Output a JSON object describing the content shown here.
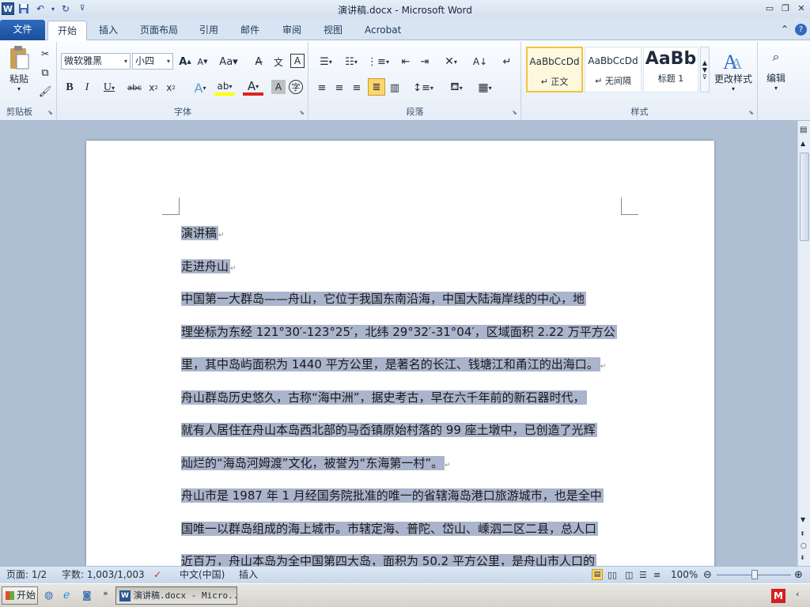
{
  "window": {
    "title": "演讲稿.docx - Microsoft Word"
  },
  "tabs": [
    {
      "label": "文件"
    },
    {
      "label": "开始"
    },
    {
      "label": "插入"
    },
    {
      "label": "页面布局"
    },
    {
      "label": "引用"
    },
    {
      "label": "邮件"
    },
    {
      "label": "审阅"
    },
    {
      "label": "视图"
    },
    {
      "label": "Acrobat"
    }
  ],
  "ribbon": {
    "clipboard": {
      "paste": "粘贴",
      "label": "剪贴板"
    },
    "font": {
      "family": "微软雅黑",
      "size": "小四",
      "label": "字体"
    },
    "paragraph": {
      "label": "段落"
    },
    "styles": {
      "label": "样式",
      "items": [
        {
          "preview": "AaBbCcDd",
          "name": "↵ 正文"
        },
        {
          "preview": "AaBbCcDd",
          "name": "↵ 无间隔"
        },
        {
          "preview": "AaBb",
          "name": "标题 1"
        }
      ],
      "change": "更改样式"
    },
    "editing": {
      "label": "编辑"
    }
  },
  "document": {
    "lines": [
      {
        "text": "演讲稿",
        "mark": "↵"
      },
      {
        "text": "走进舟山",
        "mark": "↵"
      },
      {
        "text": "中国第一大群岛——舟山，它位于我国东南沿海，中国大陆海岸线的中心，地",
        "mark": ""
      },
      {
        "text": "理坐标为东经 121°30′-123°25′，北纬 29°32′-31°04′，区域面积 2.22 万平方公",
        "mark": ""
      },
      {
        "text": "里，其中岛屿面积为 1440 平方公里，是著名的长江、钱塘江和甬江的出海口。",
        "mark": "↵"
      },
      {
        "text": "舟山群岛历史悠久，古称“海中洲”，据史考古，早在六千年前的新石器时代，",
        "mark": ""
      },
      {
        "text": "就有人居住在舟山本岛西北部的马岙镇原始村落的 99 座土墩中，已创造了光辉",
        "mark": ""
      },
      {
        "text": "灿烂的“海岛河姆渡”文化，被誉为“东海第一村”。",
        "mark": "↵"
      },
      {
        "text": "舟山市是 1987 年 1 月经国务院批准的唯一的省辖海岛港口旅游城市，也是全中",
        "mark": ""
      },
      {
        "text": "国唯一以群岛组成的海上城市。市辖定海、普陀、岱山、嵊泗二区二县，总人口",
        "mark": ""
      },
      {
        "text": "近百万，舟山本岛为全中国第四大岛，面积为 50.2 平方公里，是舟山市人口的",
        "mark": ""
      }
    ]
  },
  "status": {
    "page": "页面: 1/2",
    "words": "字数: 1,003/1,003",
    "language": "中文(中国)",
    "mode": "插入",
    "zoom": "100%"
  },
  "taskbar": {
    "start": "开始",
    "item": "演讲稿.docx - Micro..."
  },
  "colors": {
    "selection": "#aab4cc",
    "file_tab": "#2b5797"
  }
}
